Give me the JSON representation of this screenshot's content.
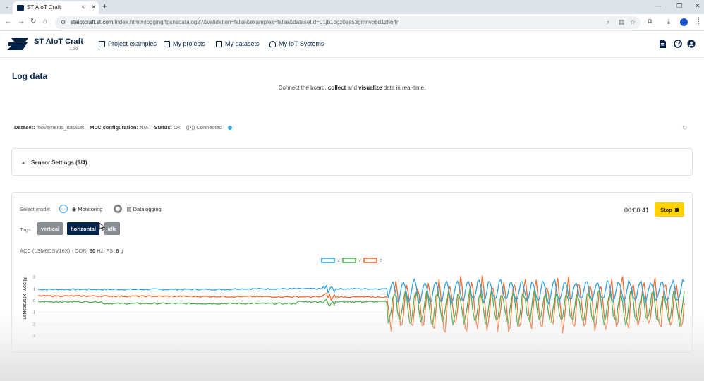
{
  "browser": {
    "tab_title": "ST AIoT Craft",
    "url_host": "staiotcraft.st.com",
    "url_path": "/index.html#/logging/fpsnsdatalog2?&validation=false&examples=false&datasetId=01jb1bgz0es53gmnvb6d1zh64r"
  },
  "app": {
    "brand": "ST AIoT Craft",
    "version": "1.0.0",
    "nav": [
      {
        "label": "Project examples"
      },
      {
        "label": "My projects"
      },
      {
        "label": "My datasets"
      },
      {
        "label": "My IoT Systems"
      }
    ]
  },
  "page": {
    "title": "Log data",
    "subtitle_pre": "Connect the board, ",
    "subtitle_b1": "collect",
    "subtitle_mid": " and ",
    "subtitle_b2": "visualize",
    "subtitle_post": " data in real-time."
  },
  "info": {
    "dataset_label": "Dataset:",
    "dataset_value": "movements_dataset",
    "mlc_label": "MLC configuration:",
    "mlc_value": "N/A",
    "status_label": "Status:",
    "status_value": "Ok",
    "connection": "Connected",
    "connection_color": "#39a9dc"
  },
  "sensor_settings": {
    "label": "Sensor Settings (1/4)"
  },
  "logging": {
    "mode_label": "Select mode:",
    "mode_monitoring": "Monitoring",
    "mode_datalogging": "Datalogging",
    "selected_mode": "Datalogging",
    "timer": "00:00:41",
    "stop_label": "Stop",
    "stop_color": "#ffd200",
    "tags_label": "Tags:",
    "tags": [
      {
        "label": "vertical",
        "active": false
      },
      {
        "label": "horizontal",
        "active": true
      },
      {
        "label": "idle",
        "active": false
      }
    ],
    "sensor_pre": "ACC (LSM6DSV16X) - ODR: ",
    "sensor_odr": "60",
    "sensor_mid": " Hz, FS: ",
    "sensor_fs": "8",
    "sensor_unit": " g"
  },
  "chart_data": {
    "type": "line",
    "ylabel": "LSM6DSV16X - ACC (g)",
    "yticks": [
      2,
      1,
      0,
      -1,
      -2,
      -3
    ],
    "ylim": [
      -3,
      3
    ],
    "legend_position": "top-center",
    "series": [
      {
        "name": "X",
        "color": "#2ea3dd"
      },
      {
        "name": "Y",
        "color": "#4caf50"
      },
      {
        "name": "Z",
        "color": "#f26b2e"
      }
    ]
  }
}
